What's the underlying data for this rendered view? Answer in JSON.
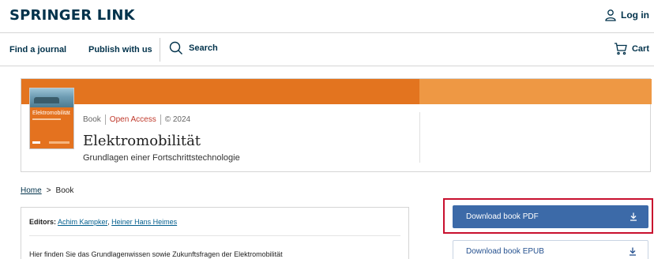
{
  "header": {
    "logo": "SPRINGER LINK",
    "login_label": "Log in"
  },
  "nav": {
    "find_journal": "Find a journal",
    "publish": "Publish with us",
    "search": "Search",
    "cart": "Cart"
  },
  "book": {
    "type": "Book",
    "access": "Open Access",
    "year": "© 2024",
    "title": "Elektromobilität",
    "subtitle": "Grundlagen einer Fortschrittstechnologie",
    "cover_title": "Elektromobilität"
  },
  "breadcrumb": {
    "home": "Home",
    "separator": ">",
    "current": "Book"
  },
  "info": {
    "editors_label": "Editors:",
    "editor_1": "Achim Kampker",
    "separator": ",",
    "editor_2": "Heiner Hans Heimes",
    "summary": "Hier finden Sie das Grundlagenwissen sowie Zukunftsfragen der Elektromobilität"
  },
  "downloads": {
    "pdf_label": "Download book PDF",
    "epub_label": "Download book EPUB"
  },
  "colors": {
    "brand_navy": "#01324b",
    "orange": "#e3741f",
    "button_blue": "#3c6aa8",
    "highlight_red": "#c8102e"
  }
}
